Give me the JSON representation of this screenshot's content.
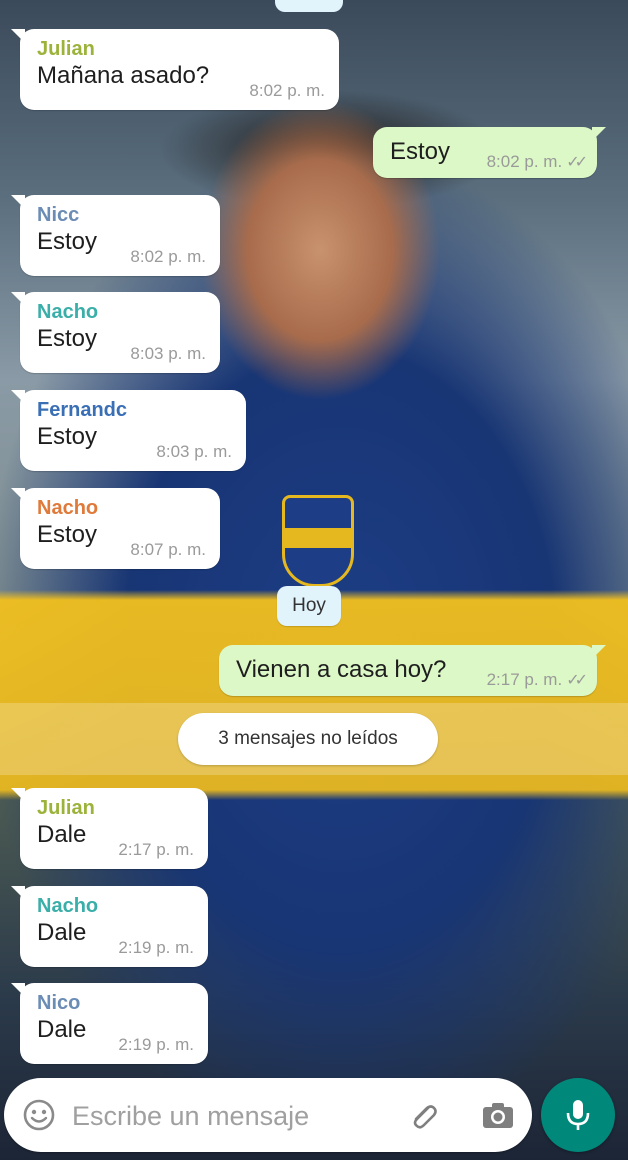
{
  "colors": {
    "bubble_in": "#ffffff",
    "bubble_out": "#dcf8c6",
    "mic_button": "#00897b",
    "date_pill": "#e1f3fb"
  },
  "messages": [
    {
      "direction": "in",
      "sender": "Julian",
      "sender_color": "#9bb33a",
      "text": "Mañana asado?",
      "time": "8:02 p. m."
    },
    {
      "direction": "out",
      "text": "Estoy",
      "time": "8:02 p. m.",
      "status_icon": "double-check-icon",
      "ticks": "✓✓"
    },
    {
      "direction": "in",
      "sender": "Nicc",
      "sender_color": "#6b8cb5",
      "text": "Estoy",
      "time": "8:02 p. m."
    },
    {
      "direction": "in",
      "sender": "Nacho",
      "sender_color": "#3aaea8",
      "text": "Estoy",
      "time": "8:03 p. m."
    },
    {
      "direction": "in",
      "sender": "Fernandc",
      "sender_color": "#3a6fb5",
      "text": "Estoy",
      "time": "8:03 p. m."
    },
    {
      "direction": "in",
      "sender": "Nacho",
      "sender_color": "#e07a3a",
      "text": "Estoy",
      "time": "8:07 p. m."
    },
    {
      "direction": "out",
      "text": "Vienen a casa hoy?",
      "time": "2:17 p. m.",
      "status_icon": "double-check-icon",
      "ticks": "✓✓"
    },
    {
      "direction": "in",
      "sender": "Julian",
      "sender_color": "#9bb33a",
      "text": "Dale",
      "time": "2:17 p. m."
    },
    {
      "direction": "in",
      "sender": "Nacho",
      "sender_color": "#3aaea8",
      "text": "Dale",
      "time": "2:19 p. m."
    },
    {
      "direction": "in",
      "sender": "Nico",
      "sender_color": "#6b8cb5",
      "text": "Dale",
      "time": "2:19 p. m."
    }
  ],
  "date_divider": "Hoy",
  "unread_divider": "3 mensajes no leídos",
  "composer": {
    "placeholder": "Escribe un mensaje",
    "emoji_icon": "emoji-icon",
    "attach_icon": "paperclip-icon",
    "camera_icon": "camera-icon",
    "mic_icon": "microphone-icon"
  }
}
